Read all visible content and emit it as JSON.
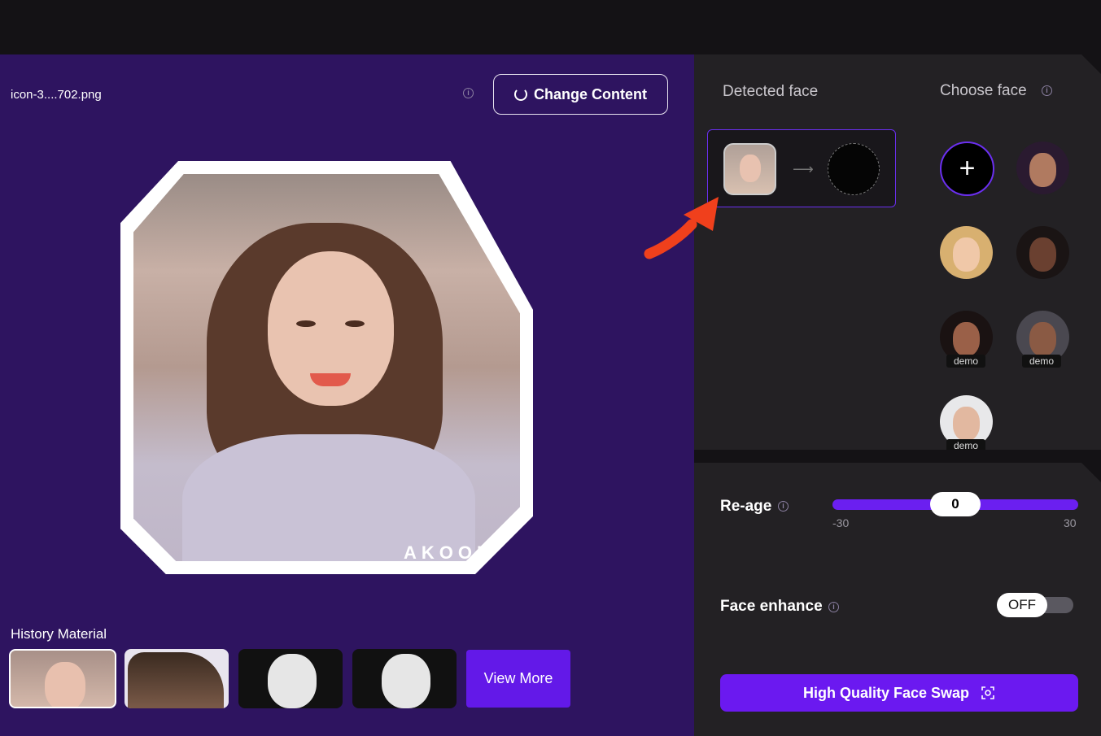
{
  "editor": {
    "filename": "icon-3....702.png",
    "change_content_label": "Change Content",
    "watermark": "AKOOL"
  },
  "history": {
    "title": "History Material",
    "view_more_label": "View More"
  },
  "face_panel": {
    "detected_title": "Detected face",
    "choose_title": "Choose face",
    "demo_label": "demo"
  },
  "reage": {
    "label": "Re-age",
    "value": "0",
    "min": "-30",
    "max": "30"
  },
  "enhance": {
    "label": "Face enhance",
    "state": "OFF"
  },
  "actions": {
    "hq_swap_label": "High Quality Face Swap"
  },
  "colors": {
    "accent": "#6b19f0",
    "left_bg": "#2e1460",
    "panel_bg": "#232124",
    "pointer": "#f0401c"
  }
}
